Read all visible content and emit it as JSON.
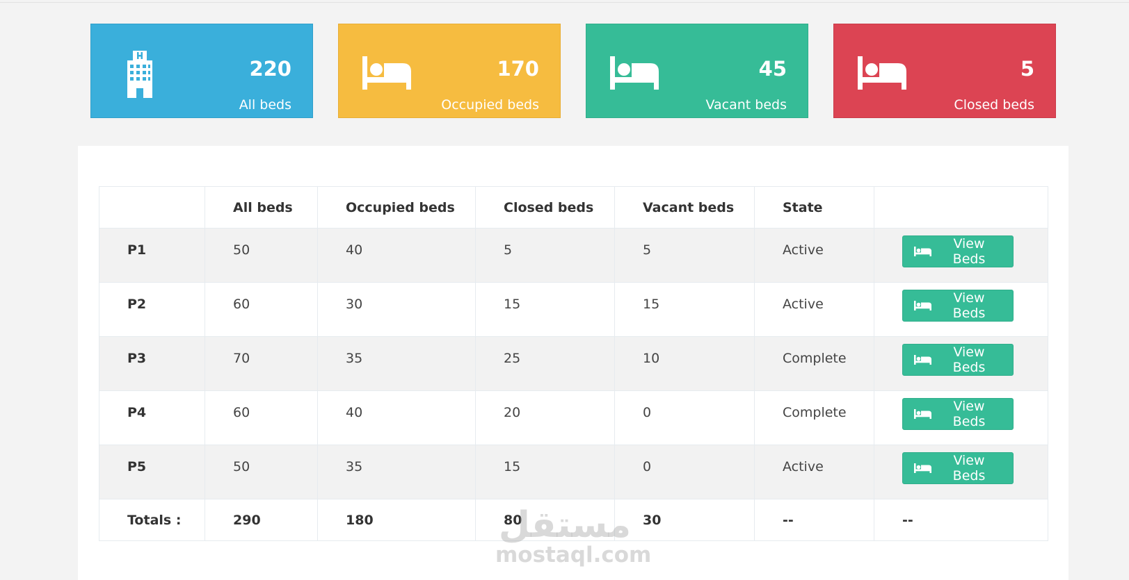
{
  "colors": {
    "blue": "#3aafdb",
    "yellow": "#f6bc40",
    "green": "#36bc97",
    "red": "#dc4453"
  },
  "cards": [
    {
      "icon": "hospital-icon",
      "value": "220",
      "label": "All beds"
    },
    {
      "icon": "bed-icon",
      "value": "170",
      "label": "Occupied beds"
    },
    {
      "icon": "bed-icon",
      "value": "45",
      "label": "Vacant beds"
    },
    {
      "icon": "bed-icon",
      "value": "5",
      "label": "Closed beds"
    }
  ],
  "table": {
    "headers": [
      "",
      "All beds",
      "Occupied beds",
      "Closed beds",
      "Vacant beds",
      "State",
      ""
    ],
    "rows": [
      {
        "name": "P1",
        "all": "50",
        "occupied": "40",
        "closed": "5",
        "vacant": "5",
        "state": "Active",
        "action": "View Beds"
      },
      {
        "name": "P2",
        "all": "60",
        "occupied": "30",
        "closed": "15",
        "vacant": "15",
        "state": "Active",
        "action": "View Beds"
      },
      {
        "name": "P3",
        "all": "70",
        "occupied": "35",
        "closed": "25",
        "vacant": "10",
        "state": "Complete",
        "action": "View Beds"
      },
      {
        "name": "P4",
        "all": "60",
        "occupied": "40",
        "closed": "20",
        "vacant": "0",
        "state": "Complete",
        "action": "View Beds"
      },
      {
        "name": "P5",
        "all": "50",
        "occupied": "35",
        "closed": "15",
        "vacant": "0",
        "state": "Active",
        "action": "View Beds"
      }
    ],
    "totals": {
      "label": "Totals :",
      "all": "290",
      "occupied": "180",
      "closed": "80",
      "vacant": "30",
      "state": "--",
      "action": "--"
    }
  },
  "watermark": {
    "arabic": "مستقل",
    "latin": "mostaql.com"
  }
}
